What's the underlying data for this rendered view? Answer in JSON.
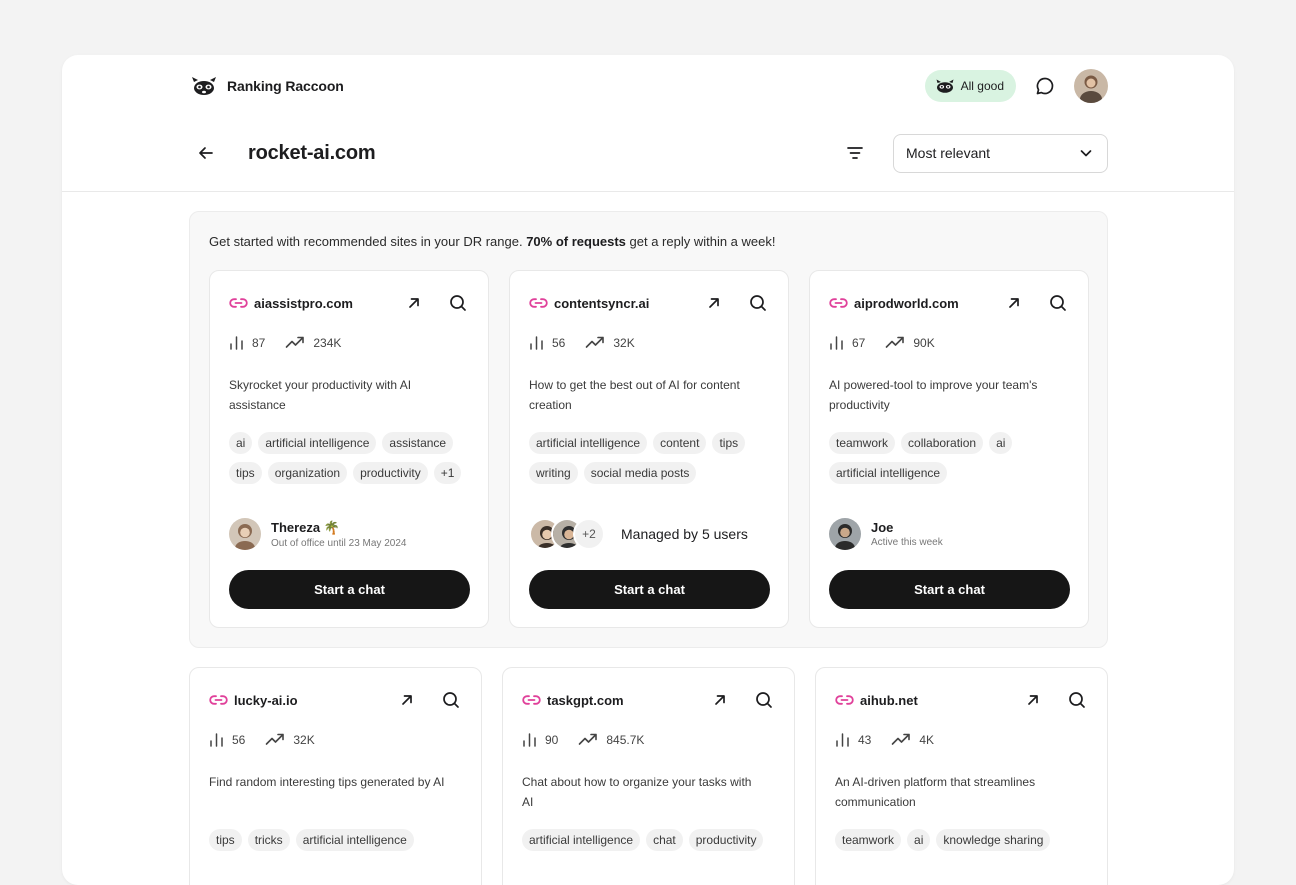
{
  "brand": {
    "name": "Ranking Raccoon"
  },
  "status": {
    "label": "All good"
  },
  "header": {
    "title": "rocket-ai.com",
    "sort_value": "Most relevant"
  },
  "recommended": {
    "intro_prefix": "Get started with recommended sites in your DR range. ",
    "intro_bold": "70% of requests",
    "intro_suffix": " get a reply within a week!"
  },
  "chat_label": "Start a chat",
  "cards": [
    {
      "domain": "aiassistpro.com",
      "dr": "87",
      "traffic": "234K",
      "description": "Skyrocket your productivity with AI assistance",
      "tags": [
        "ai",
        "artificial intelligence",
        "assistance",
        "tips",
        "organization",
        "productivity",
        "+1"
      ],
      "owner_name": "Thereza 🌴",
      "owner_sub": "Out of office until 23 May 2024"
    },
    {
      "domain": "contentsyncr.ai",
      "dr": "56",
      "traffic": "32K",
      "description": "How to get the best out of AI for content creation",
      "tags": [
        "artificial intelligence",
        "content",
        "tips",
        "writing",
        "social media posts"
      ],
      "more_count": "+2",
      "managed_label": "Managed by 5 users"
    },
    {
      "domain": "aiprodworld.com",
      "dr": "67",
      "traffic": "90K",
      "description": "AI powered-tool to improve your team's productivity",
      "tags": [
        "teamwork",
        "collaboration",
        "ai",
        "artificial intelligence"
      ],
      "owner_name": "Joe",
      "owner_sub": "Active this week"
    },
    {
      "domain": "lucky-ai.io",
      "dr": "56",
      "traffic": "32K",
      "description": "Find random interesting tips generated by AI",
      "tags": [
        "tips",
        "tricks",
        "artificial intelligence"
      ]
    },
    {
      "domain": "taskgpt.com",
      "dr": "90",
      "traffic": "845.7K",
      "description": "Chat about how to organize your tasks with AI",
      "tags": [
        "artificial intelligence",
        "chat",
        "productivity"
      ]
    },
    {
      "domain": "aihub.net",
      "dr": "43",
      "traffic": "4K",
      "description": "An AI-driven platform that streamlines communication",
      "tags": [
        "teamwork",
        "ai",
        "knowledge sharing"
      ]
    }
  ],
  "colors": {
    "accent_link": "#e0409a",
    "status_bg": "#d9f3e1",
    "button_bg": "#161616"
  }
}
